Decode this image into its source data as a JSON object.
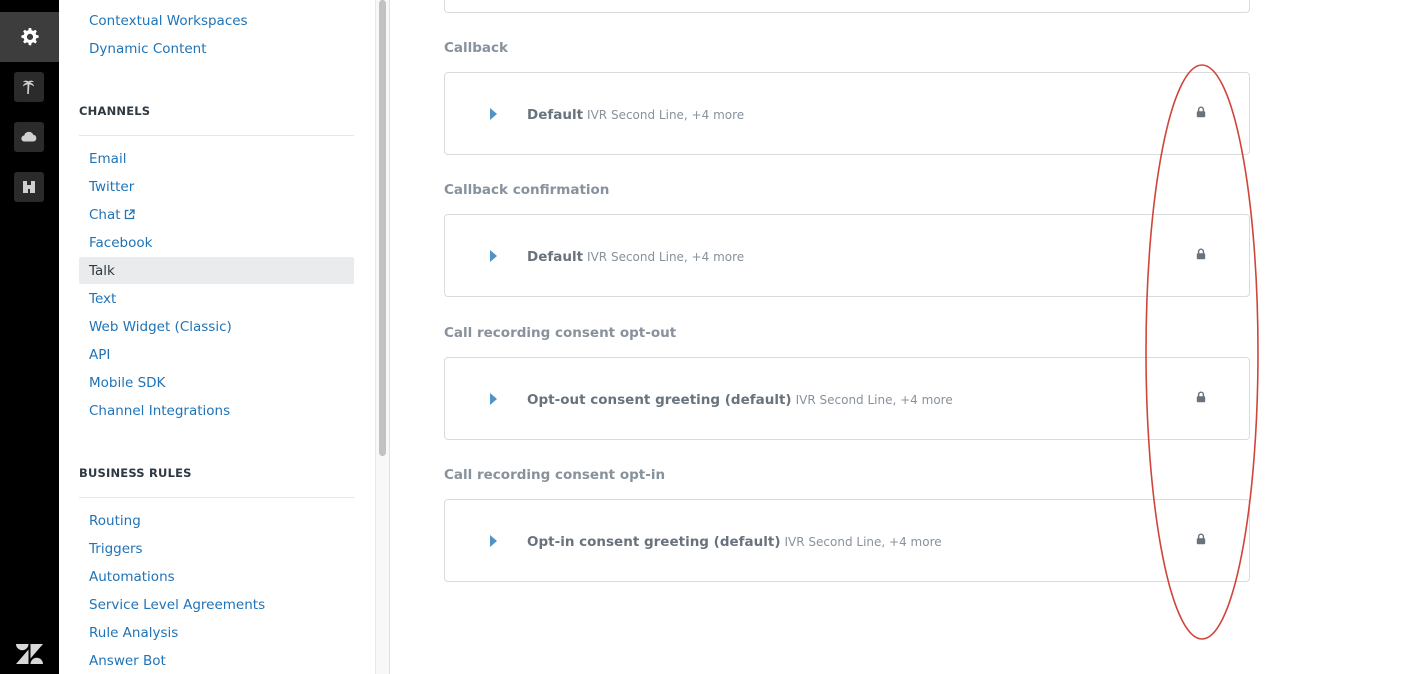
{
  "sidebar": {
    "top_links": [
      "Contextual Workspaces",
      "Dynamic Content"
    ],
    "channels": {
      "heading": "CHANNELS",
      "items": [
        "Email",
        "Twitter",
        "Chat",
        "Facebook",
        "Talk",
        "Text",
        "Web Widget (Classic)",
        "API",
        "Mobile SDK",
        "Channel Integrations"
      ],
      "selected": "Talk"
    },
    "business_rules": {
      "heading": "BUSINESS RULES",
      "items": [
        "Routing",
        "Triggers",
        "Automations",
        "Service Level Agreements",
        "Rule Analysis",
        "Answer Bot"
      ]
    }
  },
  "rail": {
    "icons": [
      "gear-icon",
      "palm-tree-icon",
      "cloud-icon",
      "binoculars-icon"
    ],
    "logo": "zendesk-logo-icon"
  },
  "groups": [
    {
      "title": "Callback",
      "card": {
        "name": "Default",
        "meta": "IVR Second Line, +4 more"
      }
    },
    {
      "title": "Callback confirmation",
      "card": {
        "name": "Default",
        "meta": "IVR Second Line, +4 more"
      }
    },
    {
      "title": "Call recording consent opt-out",
      "card": {
        "name": "Opt-out consent greeting (default)",
        "meta": "IVR Second Line, +4 more"
      }
    },
    {
      "title": "Call recording consent opt-in",
      "card": {
        "name": "Opt-in consent greeting (default)",
        "meta": "IVR Second Line, +4 more"
      }
    }
  ],
  "colors": {
    "link": "#1f73b7",
    "chevron": "#5293c7",
    "annotation": "#d0453a",
    "lock": "#68737d"
  }
}
